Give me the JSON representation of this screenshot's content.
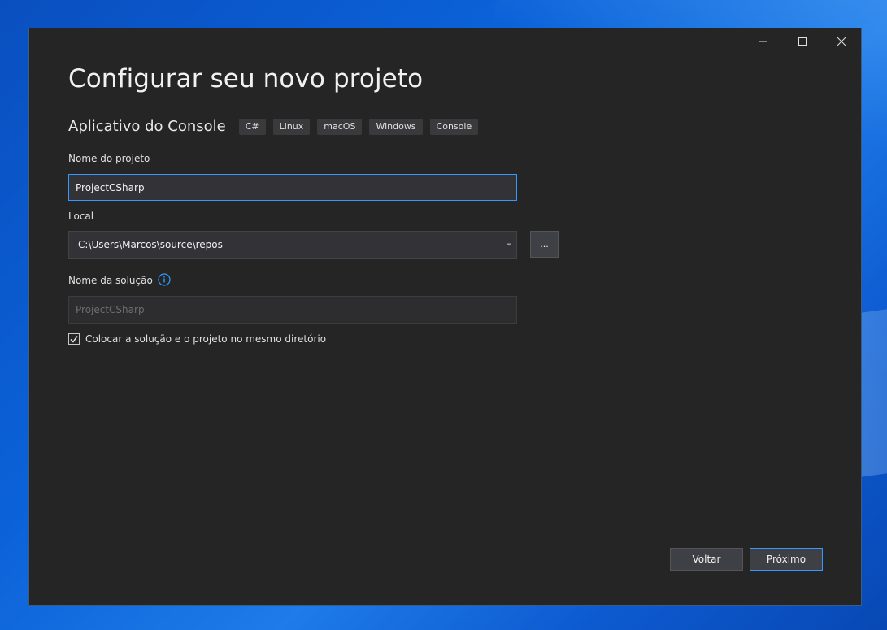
{
  "window": {
    "title": "Configurar seu novo projeto",
    "caption": {
      "minimize_icon": "minimize-icon",
      "maximize_icon": "maximize-icon",
      "close_icon": "close-icon"
    }
  },
  "template": {
    "name": "Aplicativo do Console",
    "tags": [
      "C#",
      "Linux",
      "macOS",
      "Windows",
      "Console"
    ]
  },
  "form": {
    "project_name": {
      "label": "Nome do projeto",
      "value": "ProjectCSharp"
    },
    "location": {
      "label": "Local",
      "value": "C:\\Users\\Marcos\\source\\repos",
      "browse_label": "..."
    },
    "solution_name": {
      "label": "Nome da solução",
      "placeholder": "ProjectCSharp",
      "info_icon": "info-icon"
    },
    "same_directory": {
      "label": "Colocar a solução e o projeto no mesmo diretório",
      "checked": true
    }
  },
  "footer": {
    "back_label": "Voltar",
    "next_label": "Próximo"
  },
  "colors": {
    "background": "#252526",
    "accent": "#3399ff",
    "input_bg": "#333337"
  }
}
